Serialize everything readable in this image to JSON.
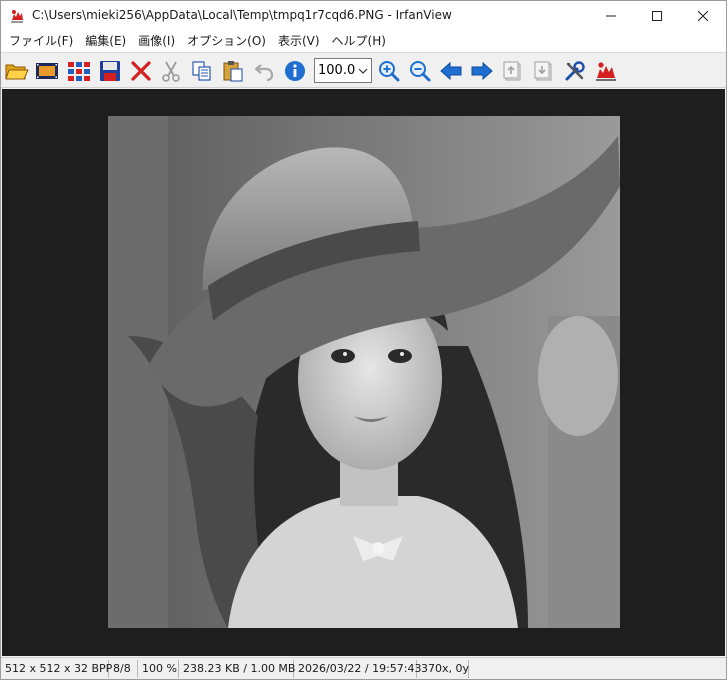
{
  "window": {
    "title": "C:\\Users\\mieki256\\AppData\\Local\\Temp\\tmpq1r7cqd6.PNG - IrfanView"
  },
  "menu": [
    {
      "label": "ファイル(F)"
    },
    {
      "label": "編集(E)"
    },
    {
      "label": "画像(I)"
    },
    {
      "label": "オプション(O)"
    },
    {
      "label": "表示(V)"
    },
    {
      "label": "ヘルプ(H)"
    }
  ],
  "toolbar": {
    "zoom_value": "100.0",
    "buttons": [
      {
        "name": "open-folder-icon"
      },
      {
        "name": "slideshow-icon"
      },
      {
        "name": "thumbnails-icon"
      },
      {
        "name": "save-icon"
      },
      {
        "name": "delete-icon"
      },
      {
        "name": "cut-icon"
      },
      {
        "name": "copy-icon"
      },
      {
        "name": "paste-icon"
      },
      {
        "name": "undo-icon"
      },
      {
        "name": "info-icon"
      },
      {
        "name": "zoom-in-icon"
      },
      {
        "name": "zoom-out-icon"
      },
      {
        "name": "previous-icon"
      },
      {
        "name": "next-icon"
      },
      {
        "name": "first-page-icon"
      },
      {
        "name": "last-page-icon"
      },
      {
        "name": "settings-icon"
      },
      {
        "name": "irfanview-logo-icon"
      }
    ]
  },
  "status": {
    "dimensions": "512 x 512 x 32 BPP",
    "index": "8/8",
    "zoom": "100 %",
    "size": "238.23 KB / 1.00 MB",
    "datetime": "2026/03/22 / 19:57:43",
    "cursor": "370x, 0y"
  },
  "colors": {
    "background": "#1e1e1e",
    "accent_blue": "#1f6fd1",
    "close_red": "#d42020"
  }
}
